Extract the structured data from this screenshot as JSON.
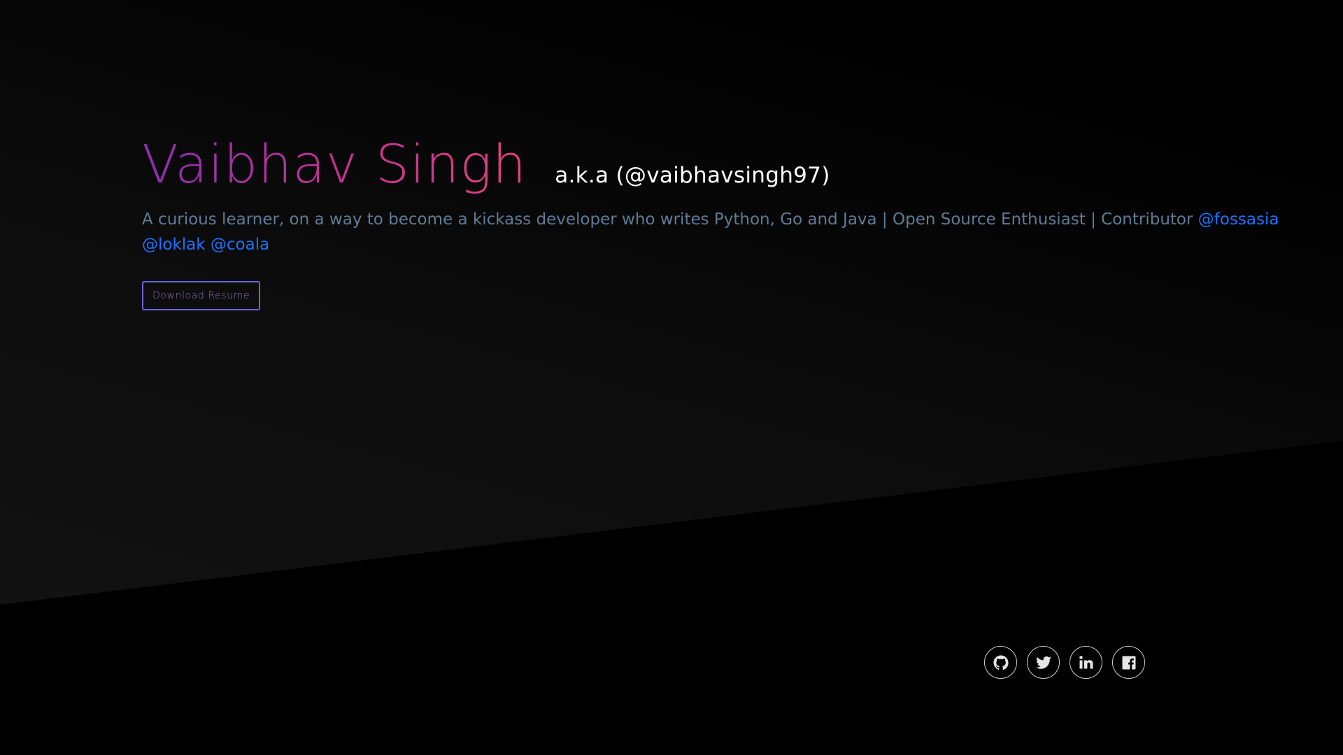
{
  "hero": {
    "name": "Vaibhav Singh",
    "aka": "a.k.a (@vaibhavsingh97)",
    "tagline": "A curious learner, on a way to become a kickass developer who writes Python, Go and Java | Open Source Enthusiast | Contributor",
    "links": [
      {
        "label": "@fossasia"
      },
      {
        "label": "@loklak"
      },
      {
        "label": "@coala"
      }
    ],
    "resume_button": "Download Resume"
  },
  "social": [
    {
      "icon": "github-icon"
    },
    {
      "icon": "twitter-icon"
    },
    {
      "icon": "linkedin-icon"
    },
    {
      "icon": "facebook-icon"
    }
  ],
  "colors": {
    "background": "#000000",
    "name_gradient_start": "#8e2db2",
    "name_gradient_end": "#e0437e",
    "tagline": "#5f7b95",
    "link": "#1a73ff",
    "button_border": "#6a63e0",
    "social_border": "#d0d0d0"
  }
}
